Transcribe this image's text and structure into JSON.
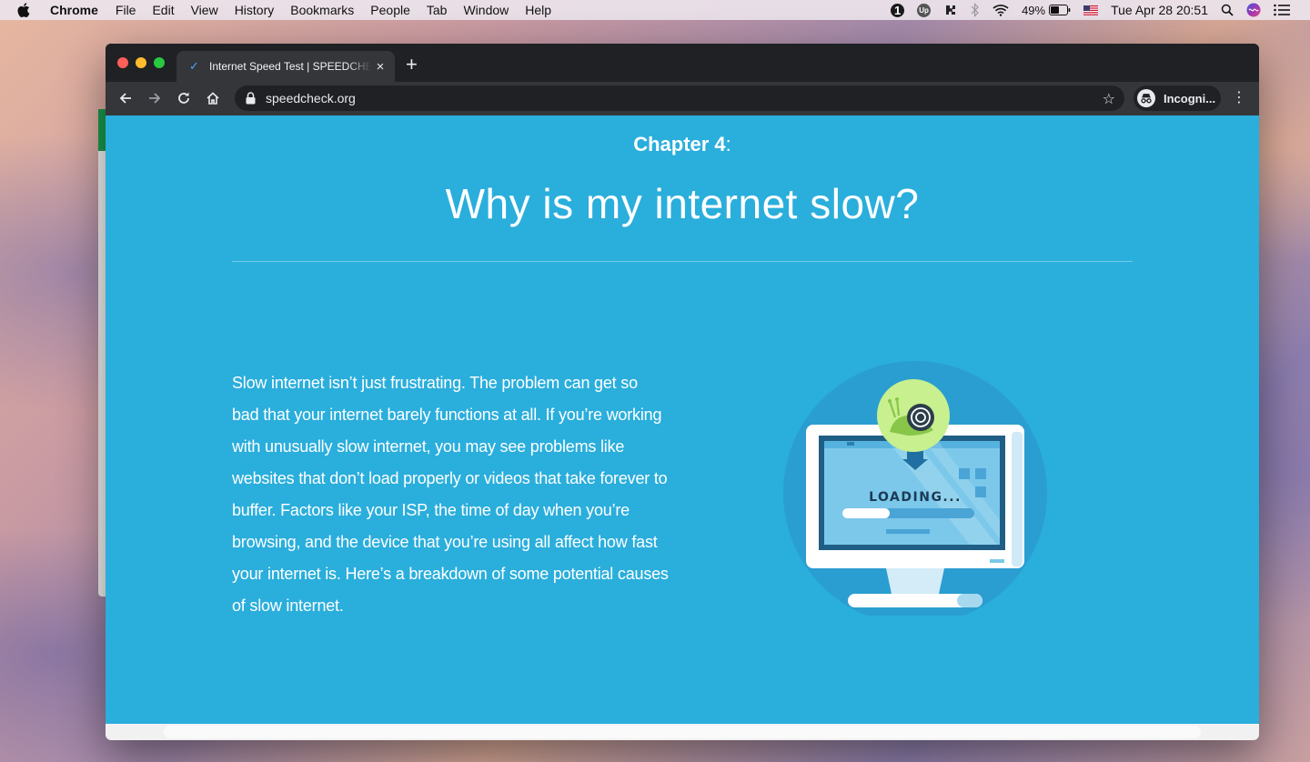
{
  "menubar": {
    "app_name": "Chrome",
    "items": [
      "File",
      "Edit",
      "View",
      "History",
      "Bookmarks",
      "People",
      "Tab",
      "Window",
      "Help"
    ],
    "status_badge": "1",
    "up_badge": "Up",
    "battery": "49%",
    "datetime": "Tue Apr 28  20:51"
  },
  "browser": {
    "tab_title": "Internet Speed Test | SPEEDCHECK",
    "tab_favicon": "✓",
    "url": "speedcheck.org",
    "profile_label": "Incogni..."
  },
  "page": {
    "chapter_label": "Chapter 4",
    "chapter_suffix": ":",
    "heading": "Why is my internet slow?",
    "body": "Slow internet isn’t just frustrating. The problem can get so bad that your internet barely functions at all. If you’re working with unusually slow internet, you may see problems like websites that don’t load properly or videos that take forever to buffer. Factors like your ISP, the time of day when you’re browsing, and the device that you’re using all affect how fast your internet is. Here’s a breakdown of some potential causes of slow internet.",
    "illustration_text": "LOADING..."
  },
  "colors": {
    "page_background": "#2aaedc",
    "chrome_dark": "#202124",
    "chrome_toolbar": "#35363a",
    "snail_badge": "#c8f08e"
  }
}
